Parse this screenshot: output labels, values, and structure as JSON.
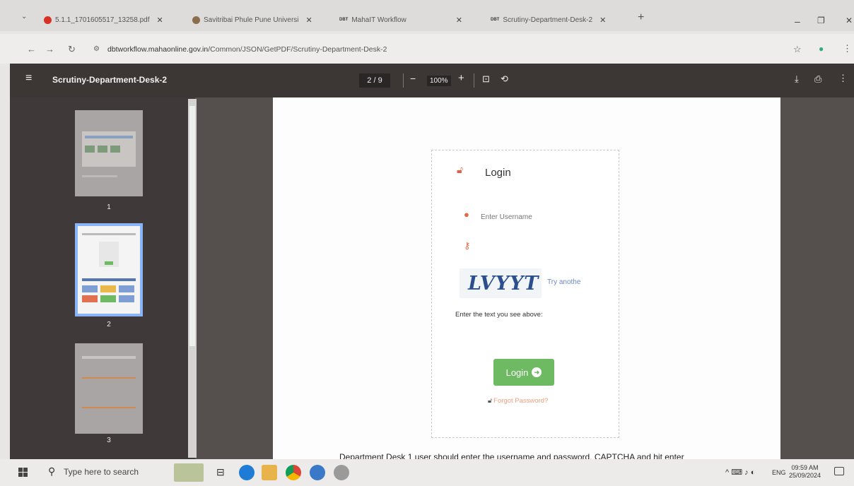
{
  "browser": {
    "tabs": [
      {
        "label": "5.1.1_1701605517_13258.pdf",
        "color": "#d93025"
      },
      {
        "label": "Savitribai Phule Pune Universi",
        "color": "#8b6e4e"
      },
      {
        "label": "MahaIT Workflow",
        "color": "#333333"
      },
      {
        "label": "Scrutiny-Department-Desk-2",
        "color": "#333333"
      }
    ],
    "tab_close": "✕",
    "tab_badge": "DBT",
    "url_host": "dbtworkflow.mahaonline.gov.in",
    "url_path": "/Common/JSON/GetPDF/Scrutiny-Department-Desk-2"
  },
  "pdf_viewer": {
    "title": "Scrutiny-Department-Desk-2",
    "page_indicator": "2 / 9",
    "zoom": "100%",
    "thumbnails": [
      "1",
      "2",
      "3"
    ],
    "active_page": 2
  },
  "page_content": {
    "login_title": "Login",
    "username_placeholder": "Enter Username",
    "captcha_text": "LVYYT",
    "try_another": "Try anothe",
    "captcha_instruction": "Enter the text you see above:",
    "login_button": "Login",
    "forgot_password": "Forgot Password?",
    "caption": "Department Desk 1 user should enter the username and password, CAPTCHA and hit enter"
  },
  "taskbar": {
    "search_placeholder": "Type here to search",
    "language": "ENG",
    "time": "09:59 AM",
    "date": "25/09/2024"
  },
  "colors": {
    "login_button": "#6dba63",
    "icon_accent": "#e06040",
    "toolbar_bg": "#3c3635"
  }
}
